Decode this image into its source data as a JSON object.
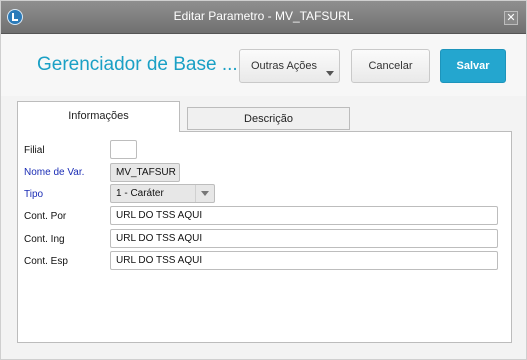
{
  "window": {
    "title": "Editar Parametro - MV_TAFSURL",
    "close_glyph": "✕",
    "icon": "totvs-app-icon"
  },
  "header": {
    "title": "Gerenciador de Base ...",
    "actions_label": "Outras Ações",
    "cancel_label": "Cancelar",
    "save_label": "Salvar"
  },
  "tabs": [
    {
      "label": "Informações",
      "active": true
    },
    {
      "label": "Descrição",
      "active": false
    }
  ],
  "form": {
    "filial": {
      "label": "Filial",
      "value": ""
    },
    "nome_var": {
      "label": "Nome de Var.",
      "value": "MV_TAFSUR"
    },
    "tipo": {
      "label": "Tipo",
      "value": "1 - Caráter"
    },
    "cont_por": {
      "label": "Cont. Por",
      "value": "URL DO TSS AQUI"
    },
    "cont_ing": {
      "label": "Cont. Ing",
      "value": "URL DO TSS AQUI"
    },
    "cont_esp": {
      "label": "Cont. Esp",
      "value": "URL DO TSS AQUI"
    }
  },
  "colors": {
    "accent": "#1aa0c5",
    "save_button": "#24a6cf",
    "required_label": "#1b2db5"
  }
}
